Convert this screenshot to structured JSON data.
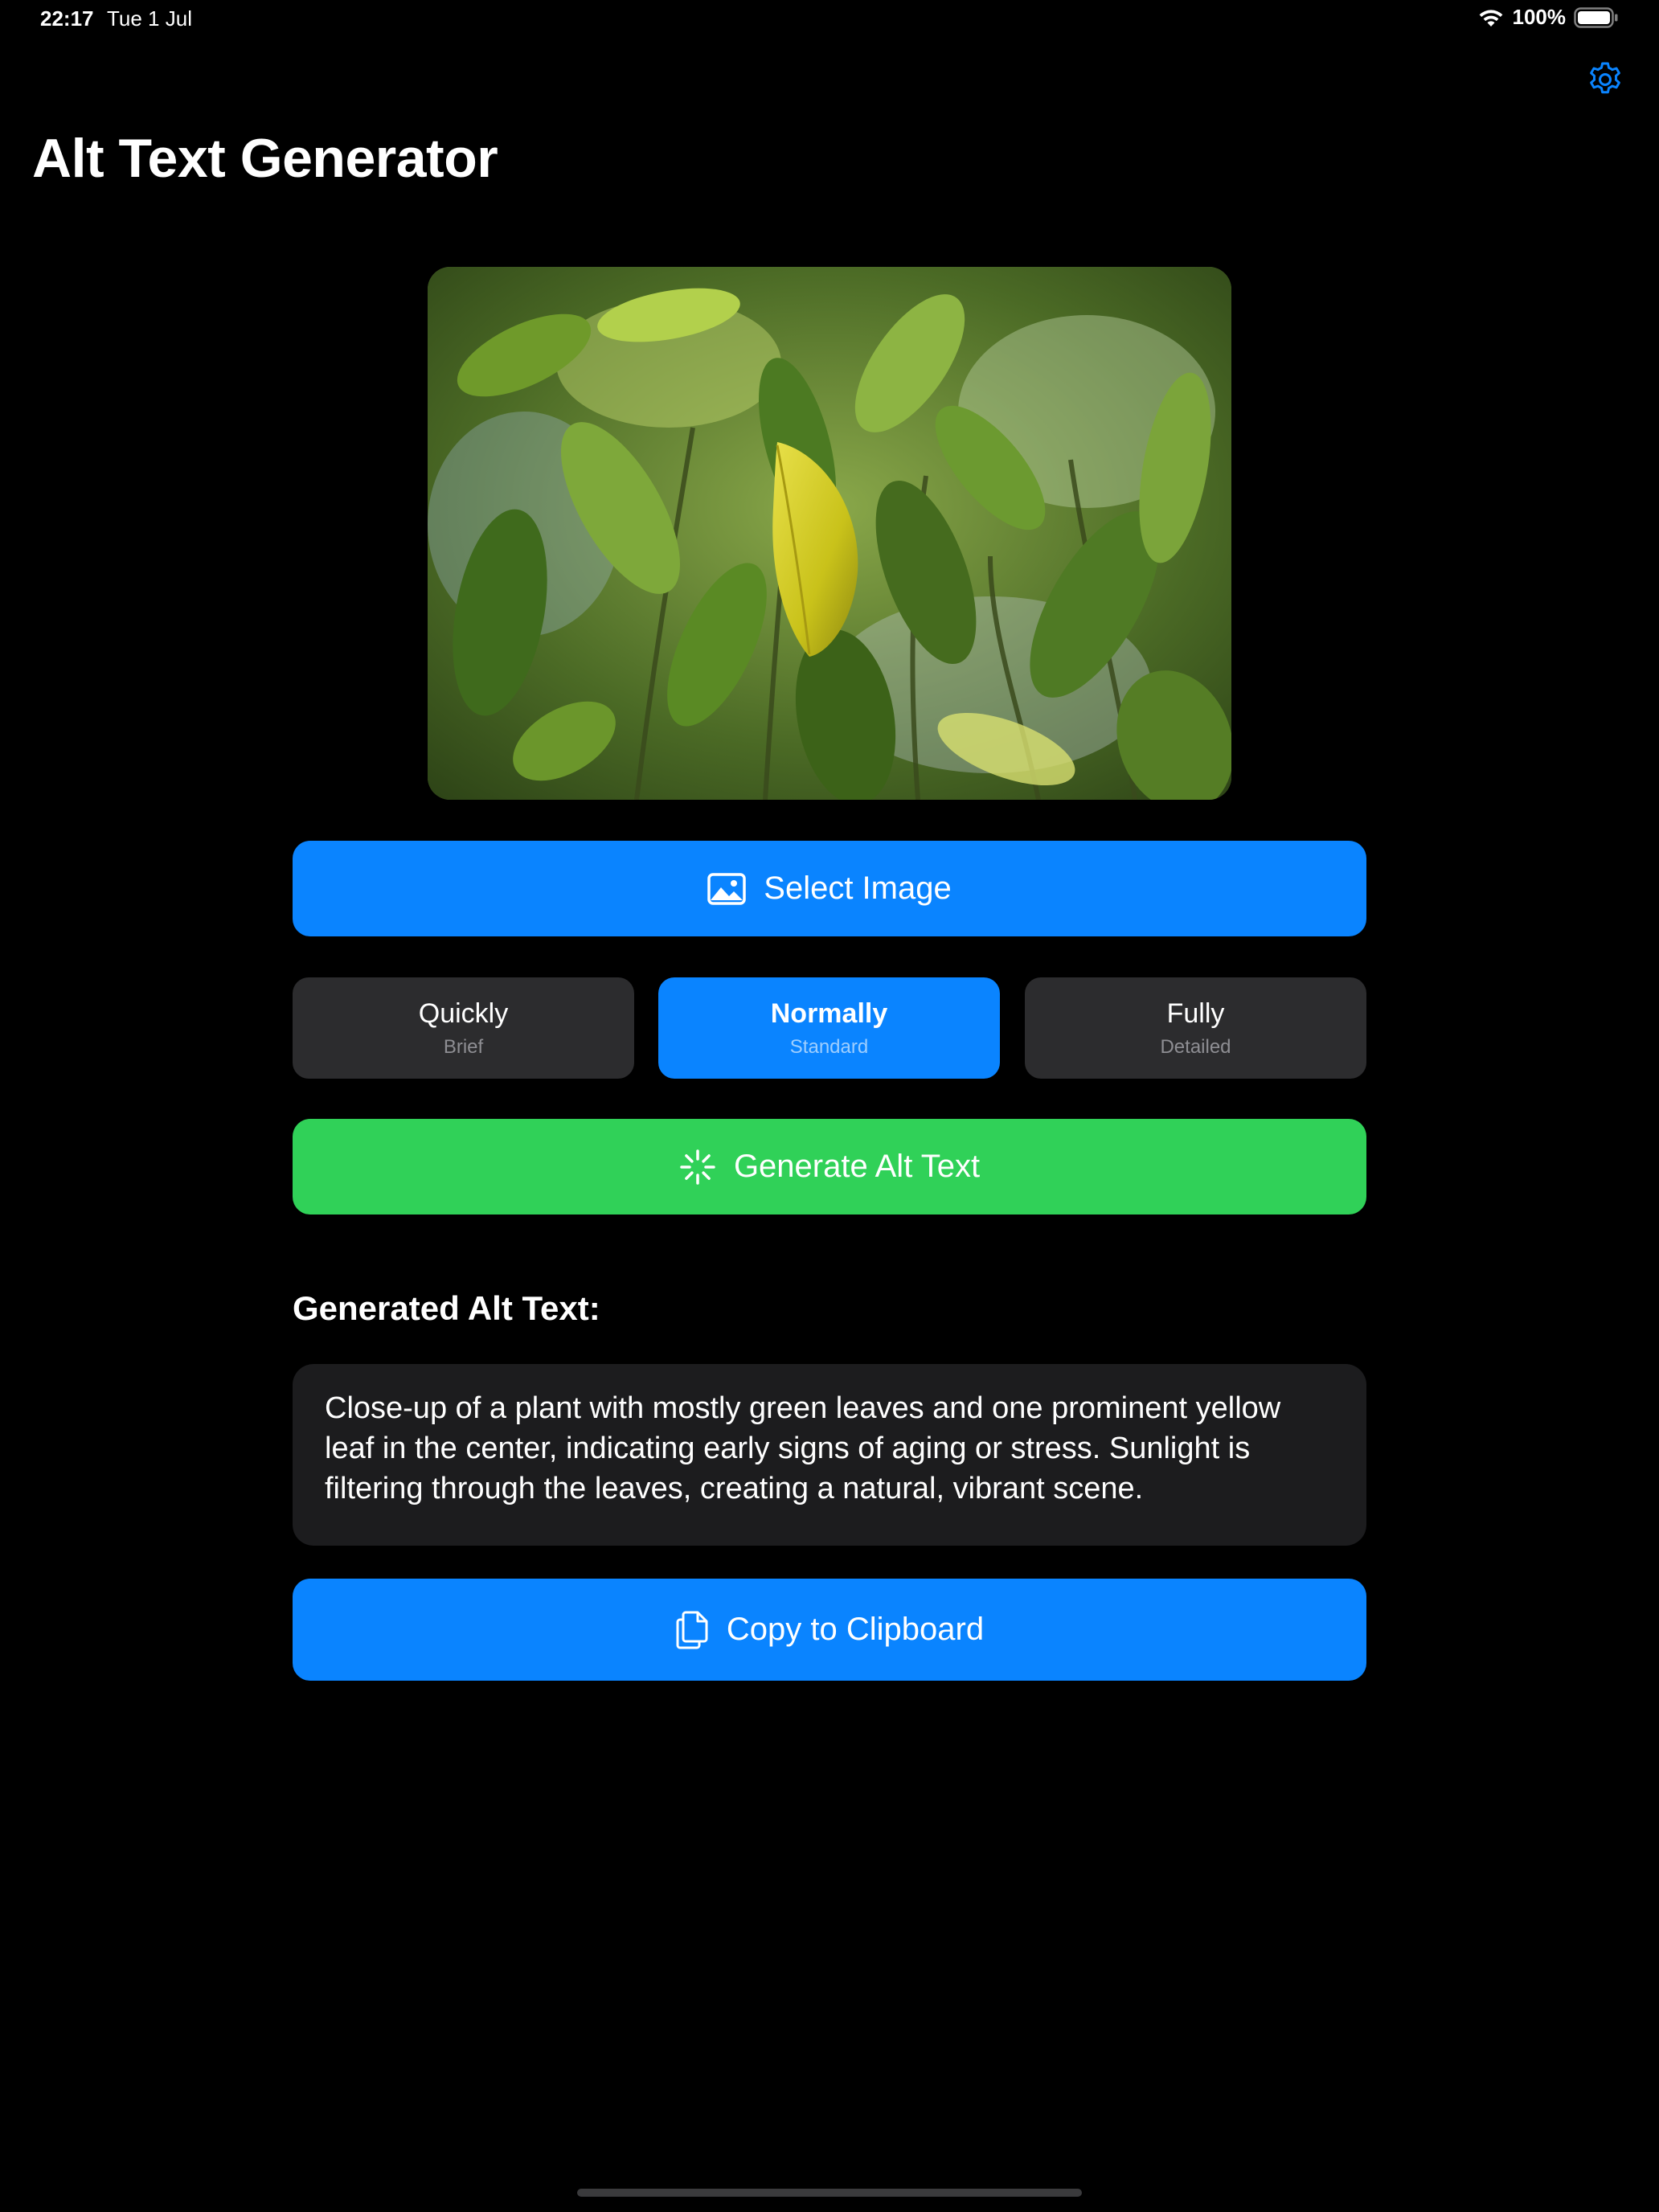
{
  "status_bar": {
    "time": "22:17",
    "date": "Tue 1 Jul",
    "battery": "100%"
  },
  "app": {
    "title": "Alt Text Generator"
  },
  "icons": {
    "settings": "gear-icon",
    "select_image": "photo-icon",
    "generate": "sparkle-icon",
    "copy": "document-copy-icon"
  },
  "actions": {
    "select_image_label": "Select Image",
    "generate_label": "Generate Alt Text",
    "copy_label": "Copy to Clipboard"
  },
  "detail_options": [
    {
      "title": "Quickly",
      "subtitle": "Brief",
      "selected": false
    },
    {
      "title": "Normally",
      "subtitle": "Standard",
      "selected": true
    },
    {
      "title": "Fully",
      "subtitle": "Detailed",
      "selected": false
    }
  ],
  "result": {
    "heading": "Generated Alt Text:",
    "text": "Close-up of a plant with mostly green leaves and one prominent yellow leaf in the center, indicating early signs of aging or stress. Sunlight is filtering through the leaves, creating a natural, vibrant scene."
  },
  "colors": {
    "accent_blue": "#0a84ff",
    "accent_green": "#30d158",
    "card_gray": "#2c2c2e",
    "background": "#000000"
  }
}
